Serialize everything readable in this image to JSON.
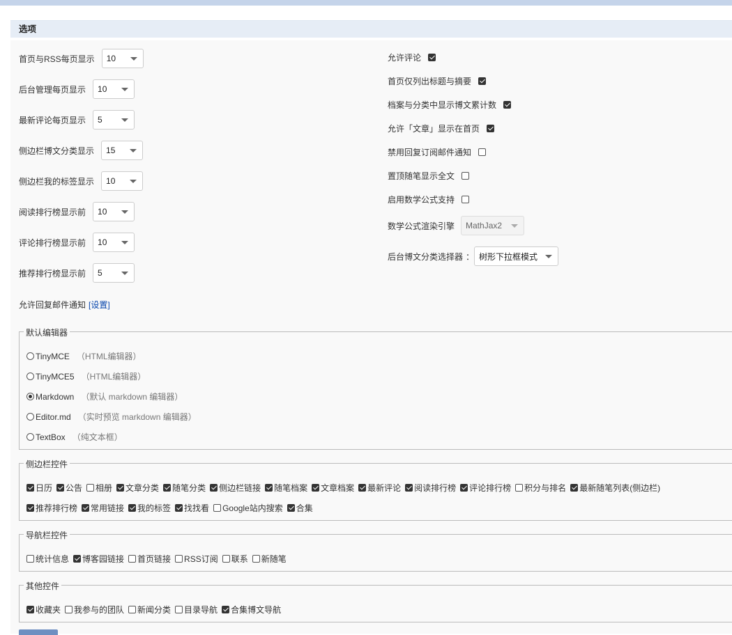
{
  "section_title": "选项",
  "left_settings": [
    {
      "label": "首页与RSS每页显示",
      "value": "10"
    },
    {
      "label": "后台管理每页显示",
      "value": "10"
    },
    {
      "label": "最新评论每页显示",
      "value": "5"
    },
    {
      "label": "侧边栏博文分类显示",
      "value": "15"
    },
    {
      "label": "侧边栏我的标签显示",
      "value": "10"
    },
    {
      "label": "阅读排行榜显示前",
      "value": "10"
    },
    {
      "label": "评论排行榜显示前",
      "value": "10"
    },
    {
      "label": "推荐排行榜显示前",
      "value": "5"
    }
  ],
  "reply_notify": {
    "label": "允许回复邮件通知",
    "link": "[设置]"
  },
  "right_settings": [
    {
      "label": "允许评论",
      "checked": true
    },
    {
      "label": "首页仅列出标题与摘要",
      "checked": true
    },
    {
      "label": "档案与分类中显示博文累计数",
      "checked": true
    },
    {
      "label": "允许「文章」显示在首页",
      "checked": true
    },
    {
      "label": "禁用回复订阅邮件通知",
      "checked": false
    },
    {
      "label": "置顶随笔显示全文",
      "checked": false
    },
    {
      "label": "启用数学公式支持",
      "checked": false
    }
  ],
  "math_engine": {
    "label": "数学公式渲染引擎",
    "value": "MathJax2"
  },
  "category_selector": {
    "label": "后台博文分类选择器",
    "colon": "：",
    "value": "树形下拉框模式"
  },
  "editor_group": {
    "legend": "默认编辑器",
    "options": [
      {
        "name": "TinyMCE",
        "desc": "（HTML编辑器）",
        "selected": false
      },
      {
        "name": "TinyMCE5",
        "desc": "（HTML编辑器）",
        "selected": false
      },
      {
        "name": "Markdown",
        "desc": "（默认 markdown 编辑器）",
        "selected": true
      },
      {
        "name": "Editor.md",
        "desc": "（实时预览 markdown 编辑器）",
        "selected": false
      },
      {
        "name": "TextBox",
        "desc": "（纯文本框）",
        "selected": false
      }
    ]
  },
  "sidebar_group": {
    "legend": "侧边栏控件",
    "lines": [
      [
        {
          "label": "日历",
          "checked": true
        },
        {
          "label": "公告",
          "checked": true
        },
        {
          "label": "相册",
          "checked": false
        },
        {
          "label": "文章分类",
          "checked": true
        },
        {
          "label": "随笔分类",
          "checked": true
        },
        {
          "label": "侧边栏链接",
          "checked": true
        },
        {
          "label": "随笔档案",
          "checked": true
        },
        {
          "label": "文章档案",
          "checked": true
        },
        {
          "label": "最新评论",
          "checked": true
        },
        {
          "label": "阅读排行榜",
          "checked": true
        },
        {
          "label": "评论排行榜",
          "checked": true
        },
        {
          "label": "积分与排名",
          "checked": false
        },
        {
          "label": "最新随笔列表(侧边栏)",
          "checked": true
        }
      ],
      [
        {
          "label": "推荐排行榜",
          "checked": true
        },
        {
          "label": "常用链接",
          "checked": true
        },
        {
          "label": "我的标签",
          "checked": true
        },
        {
          "label": "找找看",
          "checked": true
        },
        {
          "label": "Google站内搜索",
          "checked": false
        },
        {
          "label": "合集",
          "checked": true
        }
      ]
    ]
  },
  "nav_group": {
    "legend": "导航栏控件",
    "items": [
      {
        "label": "统计信息",
        "checked": false
      },
      {
        "label": "博客园链接",
        "checked": true
      },
      {
        "label": "首页链接",
        "checked": false
      },
      {
        "label": "RSS订阅",
        "checked": false
      },
      {
        "label": "联系",
        "checked": false
      },
      {
        "label": "新随笔",
        "checked": false
      }
    ]
  },
  "other_group": {
    "legend": "其他控件",
    "items": [
      {
        "label": "收藏夹",
        "checked": true
      },
      {
        "label": "我参与的团队",
        "checked": false
      },
      {
        "label": "新闻分类",
        "checked": false
      },
      {
        "label": "目录导航",
        "checked": false
      },
      {
        "label": "合集博文导航",
        "checked": true
      }
    ]
  }
}
